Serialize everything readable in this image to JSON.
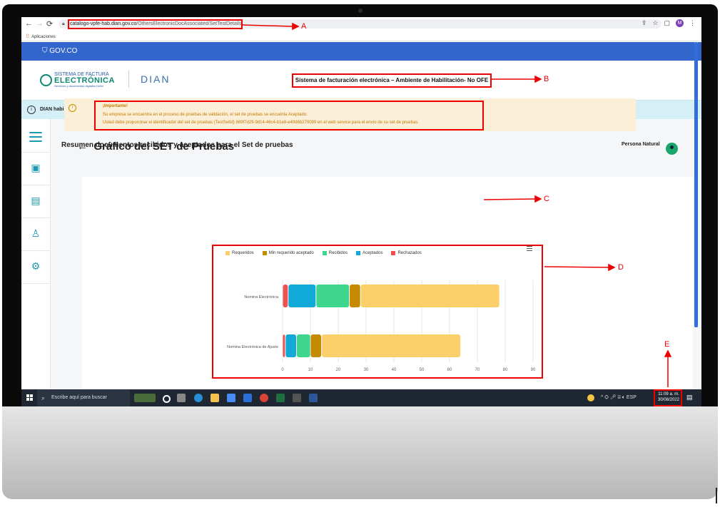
{
  "browser": {
    "url_host": "catalogo-vpfe-hab.dian.gov.co",
    "url_path": "/OthersElectronicDocAssociated/SetTestDetails",
    "bookmark_label": "Aplicaciones",
    "profile_initial": "M"
  },
  "gov": {
    "label": "GOV.CO"
  },
  "header": {
    "logo_line1": "SISTEMA DE FACTURA",
    "logo_line2": "ELECTRÓNICA",
    "logo_line3": "Servicios y documentos digitales DIAN",
    "dian_logo": "DIAN",
    "environment_title": "Sistema de facturación electrónica – Ambiente de Habilitación- No OFE"
  },
  "strip": {
    "label": "DIAN habilitación"
  },
  "page": {
    "title": "Gráfico del SET de Pruebas",
    "user_name": "Persona Natural"
  },
  "alert": {
    "title": "¡Importante!",
    "line1": "Su empresa se encuentra en el proceso de pruebas de validación, el set de pruebas se encuenta Aceptado.",
    "line2": "Usted debe proporcinar el identificador del set de pruebas (TestSetId) 869f7d29-9d14-46c4-b1e8-e40d6b270099 en el web service para el envío de su set de pruebas."
  },
  "section_title": "Resumen documentos recibidos y aceptados para el Set de pruebas",
  "chart_data": {
    "type": "bar",
    "orientation": "horizontal",
    "stacked": true,
    "categories": [
      "Nomina Electrónica",
      "Nomina Electrónica de Ajuste"
    ],
    "series": [
      {
        "name": "Requeridos",
        "color": "#fbd06b",
        "values": [
          50,
          50
        ]
      },
      {
        "name": "Min requerido aceptado",
        "color": "#c58a00",
        "values": [
          4,
          4
        ]
      },
      {
        "name": "Recibidos",
        "color": "#3dd68c",
        "values": [
          12,
          5
        ]
      },
      {
        "name": "Aceptados",
        "color": "#10a9d8",
        "values": [
          10,
          4
        ]
      },
      {
        "name": "Rechazados",
        "color": "#f0504f",
        "values": [
          2,
          1
        ]
      }
    ],
    "draw_order": [
      "Rechazados",
      "Aceptados",
      "Recibidos",
      "Min requerido aceptado",
      "Requeridos"
    ],
    "x_ticks": [
      0,
      10,
      20,
      30,
      40,
      50,
      60,
      70,
      80,
      90
    ],
    "xlim": [
      0,
      90
    ],
    "legend_position": "top",
    "grid": true
  },
  "callouts": [
    "A",
    "B",
    "C",
    "D",
    "E"
  ],
  "taskbar": {
    "search_placeholder": "Escribe aquí para buscar",
    "lang": "ESP",
    "time": "11:09 a. m.",
    "date": "30/08/2022"
  }
}
